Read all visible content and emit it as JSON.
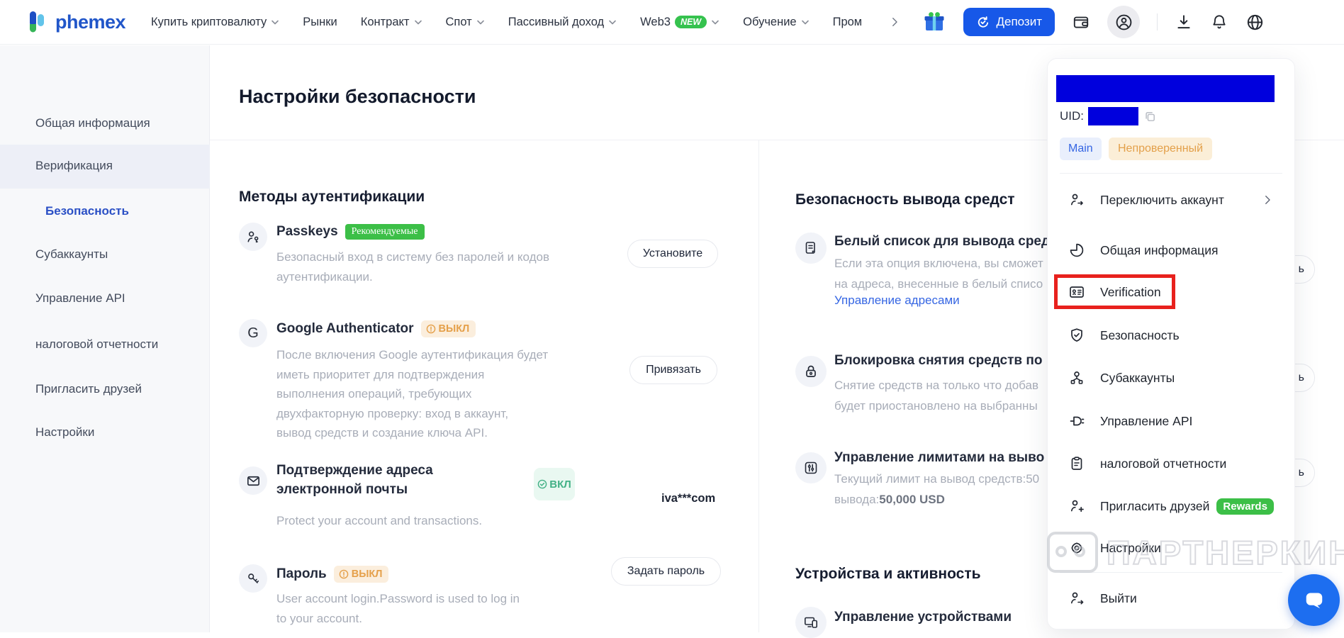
{
  "header": {
    "brand": "phemex",
    "nav_items": [
      {
        "label": "Купить криптовалюту"
      },
      {
        "label": "Рынки"
      },
      {
        "label": "Контракт"
      },
      {
        "label": "Спот"
      },
      {
        "label": "Пассивный доход"
      },
      {
        "label": "Web3",
        "badge": "NEW"
      },
      {
        "label": "Обучение"
      },
      {
        "label": "Пром"
      }
    ],
    "deposit_label": "Депозит"
  },
  "sidebar": {
    "items": [
      {
        "label": "Общая информация"
      },
      {
        "label": "Верификация"
      },
      {
        "label": "Безопасность",
        "active": true
      },
      {
        "label": "Субаккаунты"
      },
      {
        "label": "Управление API"
      },
      {
        "label": "налоговой отчетности"
      },
      {
        "label": "Пригласить друзей"
      },
      {
        "label": "Настройки"
      }
    ]
  },
  "page": {
    "title": "Настройки безопасности"
  },
  "auth": {
    "section_title": "Методы аутентификации",
    "passkeys": {
      "title": "Passkeys",
      "badge": "Рекомендуемые",
      "desc1": "Безопасный вход в систему без паролей и кодов",
      "desc2": "аутентификации.",
      "button": "Установите"
    },
    "google": {
      "title": "Google Authenticator",
      "badge": "ВЫКЛ",
      "desc1": "После включения Google аутентификация будет",
      "desc2": "иметь приоритет для подтверждения",
      "desc3": "выполнения операций, требующих",
      "desc4": "двухфакторную проверку: вход в аккаунт,",
      "desc5": "вывод средств и создание ключа API.",
      "button": "Привязать"
    },
    "email": {
      "title1": "Подтверждение адреса",
      "title2": "электронной почты",
      "badge": "ВКЛ",
      "desc": "Protect your account and transactions.",
      "value": "iva***com"
    },
    "password": {
      "title": "Пароль",
      "badge": "ВЫКЛ",
      "desc1": "User account login.Password is used to log in",
      "desc2": "to your account.",
      "button": "Задать пароль"
    }
  },
  "withdrawal": {
    "section_title": "Безопасность вывода средст",
    "whitelist": {
      "title": "Белый список для вывода сред",
      "desc1": "Если эта опция включена, вы сможет",
      "desc2": "на адреса, внесенные в белый списо",
      "link": "Управление адресами"
    },
    "lock": {
      "title": "Блокировка снятия средств по",
      "desc1": "Снятие средств на только что добав",
      "desc2": "будет приостановлено на выбранны"
    },
    "limits": {
      "title": "Управление лимитами на выво",
      "desc1": "Текущий лимит на вывод средств:50",
      "desc2a": "вывода:",
      "desc2b": "50,000 USD"
    },
    "hidden_button_fragment": "ь"
  },
  "devices": {
    "section_title": "Устройства и активность",
    "manage_title": "Управление устройствами"
  },
  "account_menu": {
    "uid_label": "UID:",
    "badges": {
      "main": "Main",
      "unverified": "Непроверенный"
    },
    "items": [
      "Переключить аккаунт",
      "Общая информация",
      "Verification",
      "Безопасность",
      "Субаккаунты",
      "Управление API",
      "налоговой отчетности",
      "Пригласить друзей",
      "Настройки",
      "Выйти"
    ],
    "rewards_badge": "Rewards"
  },
  "watermark": {
    "text": "ПАРТНЕРКИН"
  },
  "colors": {
    "accent_blue": "#1758e8",
    "link_blue": "#3566e3",
    "green": "#3cbf47",
    "warn_text": "#e3a04a",
    "warn_bg": "#fbeedd",
    "ok_text": "#43b186",
    "ok_bg": "#e9f8f1",
    "red_box": "#e8211d",
    "redaction_blue": "#0000dd",
    "chat_blue": "#1d6ef0"
  }
}
